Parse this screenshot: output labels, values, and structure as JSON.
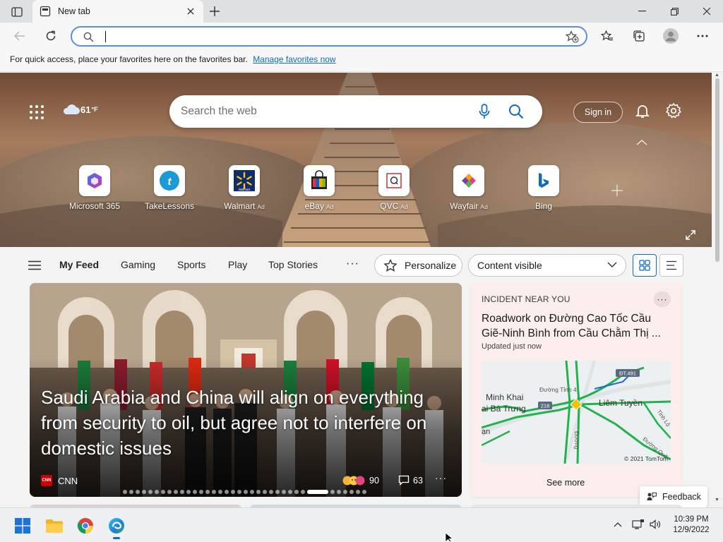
{
  "browser": {
    "tab_title": "New tab",
    "address_value": "",
    "favorites_bar_text": "For quick access, place your favorites here on the favorites bar.",
    "favorites_bar_link": "Manage favorites now"
  },
  "hero": {
    "temperature": "61",
    "temp_unit": "°F",
    "search_placeholder": "Search the web",
    "sign_in": "Sign in",
    "quick_links": [
      {
        "name": "Microsoft 365",
        "ad": ""
      },
      {
        "name": "TakeLessons",
        "ad": ""
      },
      {
        "name": "Walmart",
        "ad": "Ad"
      },
      {
        "name": "eBay",
        "ad": "Ad"
      },
      {
        "name": "QVC",
        "ad": "Ad"
      },
      {
        "name": "Wayfair",
        "ad": "Ad"
      },
      {
        "name": "Bing",
        "ad": ""
      }
    ],
    "walmart_logo_text": "Walmart"
  },
  "feed_nav": {
    "items": [
      "My Feed",
      "Gaming",
      "Sports",
      "Play",
      "Top Stories"
    ],
    "more": "···",
    "personalize": "Personalize",
    "content_visibility": "Content visible"
  },
  "story": {
    "headline": "Saudi Arabia and China will align on everything from security to oil, but agree not to interfere on domestic issues",
    "source_logo": "CNN",
    "source": "CNN",
    "reactions": "90",
    "comments": "63",
    "more": "···"
  },
  "incident": {
    "label": "INCIDENT NEAR YOU",
    "title_line1": "Roadwork on Đường Cao Tốc Cầu",
    "title_line2": "Giẽ-Ninh Bình from Cầu Chằm Thị ...",
    "updated": "Updated just now",
    "map_labels": {
      "minh_khai": "Minh Khai",
      "ba_trung": "ai Bà Trưng",
      "duong_tinh": "Đường Tỉnh 4",
      "liem_tuyen": "Liêm Tuyền",
      "dt491": "ĐT.491",
      "road218": "218",
      "tinh_lo": "Tỉnh Lộ",
      "duong_quo": "Đường Quố",
      "duong_vert": "Đường",
      "a_left": "ạn"
    },
    "map_copyright": "© 2021 TomTom",
    "see_more": "See more",
    "more": "···"
  },
  "feedback": "Feedback",
  "taskbar": {
    "time": "10:39 PM",
    "date": "12/9/2022"
  }
}
